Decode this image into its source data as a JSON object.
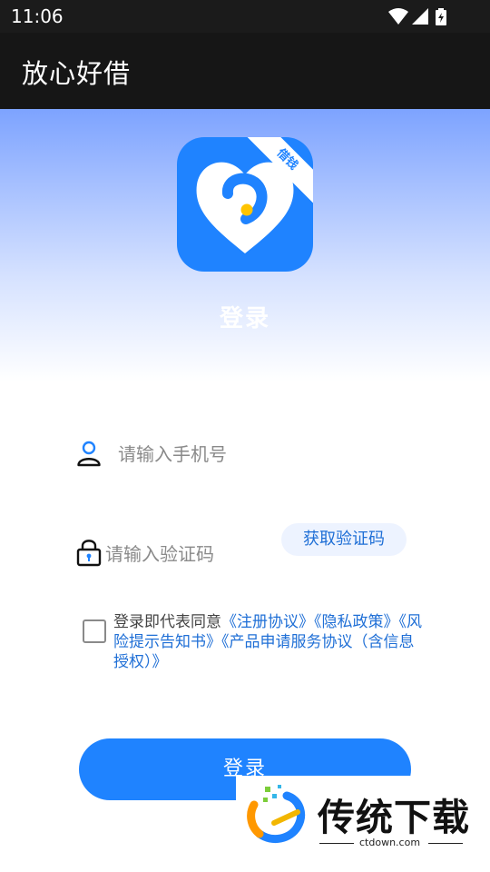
{
  "status_bar": {
    "time": "11:06",
    "icons": [
      "wifi-icon",
      "cellular-signal-icon",
      "battery-charging-icon"
    ]
  },
  "app_bar": {
    "title": "放心好借"
  },
  "hero": {
    "logo_badge": "借钱",
    "title": "登录"
  },
  "form": {
    "phone_placeholder": "请输入手机号",
    "code_placeholder": "请输入验证码",
    "get_code_label": "获取验证码",
    "agreement": {
      "prefix": "登录即代表同意",
      "links": [
        "《注册协议》",
        "《隐私政策》",
        "《风险提示告知书》",
        "《产品申请服务协议（含信息授权）》"
      ],
      "checked": false
    },
    "login_label": "登录"
  },
  "watermark": {
    "text": "传统下载",
    "url": "ctdown.com"
  },
  "colors": {
    "accent": "#1f83ff",
    "link": "#1f6fd6",
    "bar": "#161616"
  }
}
